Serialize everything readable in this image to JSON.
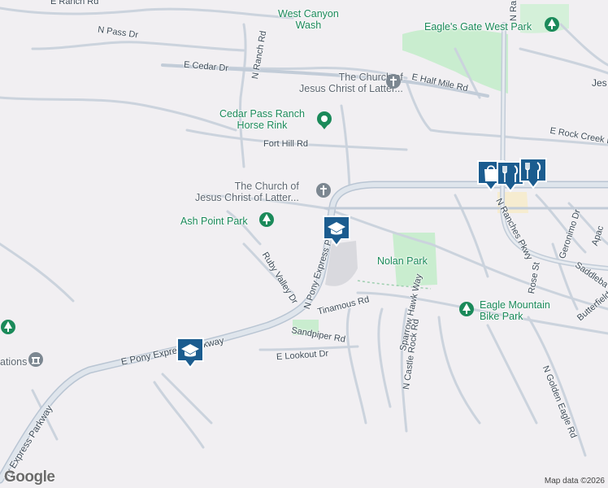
{
  "map": {
    "colors": {
      "background": "#f1eff2",
      "park": "#c9edcf",
      "road": "#ffffff",
      "road_outline": "#c8d0db",
      "highway": "#cfd8e3",
      "label": "#3d4a57",
      "park_label": "#1b8a5a",
      "pin": "#1b5c8f"
    },
    "parks": {
      "west_canyon": "West Canyon\nWash",
      "eagles_gate": "Eagle's Gate West Park",
      "cedar_pass": "Cedar Pass Ranch\nHorse Rink",
      "ash_point": "Ash Point Park",
      "nolan": "Nolan Park",
      "eagle_mountain_bike": "Eagle Mountain\nBike Park"
    },
    "places": {
      "church_north": "The Church of\nJesus Christ of Latter...",
      "church_mid": "The Church of\nJesus Christ of Latter...",
      "left_partial": "ations",
      "jes_partial": "Jes"
    },
    "roads": {
      "n_ranch_rd_top": "E Ranch Rd",
      "n_pass_dr": "N Pass Dr",
      "n_ranch_rd": "N Ranch Rd",
      "e_cedar_dr": "E Cedar Dr",
      "e_half_mile_rd": "E Half Mile Rd",
      "fort_hill_rd": "Fort Hill Rd",
      "e_rock_creek_rd": "E Rock Creek Rd",
      "n_pony_express_pkwy": "N Pony Express Pkwy",
      "ruby_valley_dr": "Ruby Valley Dr",
      "tinamous_rd": "Tinamous Rd",
      "sandpiper_rd": "Sandpiper Rd",
      "e_lookout_dr": "E Lookout Dr",
      "e_pony_express_parkway": "E Pony Express Parkway",
      "pony_express_parkway_sw": "ny Express Parkway",
      "sparrow_hawk_way": "Sparrow Hawk Way",
      "n_castle_rock_rd": "N Castle Rock Rd",
      "n_ranches_pkwy": "N Ranches Pkwy",
      "geronimo_dr": "Geronimo Dr",
      "apache": "Apac",
      "rose_st": "Rose St",
      "saddleback": "Saddleba",
      "butterfield": "Butterfield R",
      "n_golden_eagle_rd": "N Golden Eagle Rd",
      "n_ranches_top": "N Ra"
    },
    "markers": [
      "school",
      "school",
      "shopping",
      "restaurant",
      "restaurant"
    ],
    "attribution": "Map data ©2026",
    "logo": "Google"
  }
}
